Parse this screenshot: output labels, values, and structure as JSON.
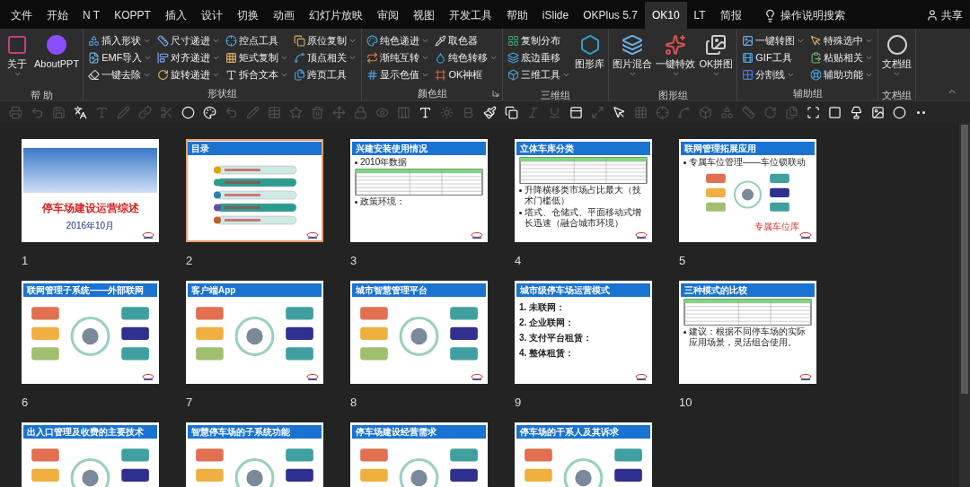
{
  "menu_tabs": [
    {
      "label": "文件",
      "selected": false
    },
    {
      "label": "开始",
      "selected": false
    },
    {
      "label": "N T",
      "selected": false
    },
    {
      "label": "KOPPT",
      "selected": false
    },
    {
      "label": "插入",
      "selected": false
    },
    {
      "label": "设计",
      "selected": false
    },
    {
      "label": "切换",
      "selected": false
    },
    {
      "label": "动画",
      "selected": false
    },
    {
      "label": "幻灯片放映",
      "selected": false
    },
    {
      "label": "审阅",
      "selected": false
    },
    {
      "label": "视图",
      "selected": false
    },
    {
      "label": "开发工具",
      "selected": false
    },
    {
      "label": "帮助",
      "selected": false
    },
    {
      "label": "iSlide",
      "selected": false
    },
    {
      "label": "OKPlus 5.7",
      "selected": false
    },
    {
      "label": "OK10",
      "selected": true
    },
    {
      "label": "LT",
      "selected": false
    },
    {
      "label": "简报",
      "selected": false
    }
  ],
  "search": {
    "placeholder": "操作说明搜索"
  },
  "share": "共享",
  "ribbon_groups": [
    {
      "label": "帮 助",
      "launcher": false,
      "items": [
        {
          "kind": "large",
          "label": "关于",
          "dropdown": true
        },
        {
          "kind": "large",
          "label": "AboutPPT",
          "dropdown": false
        }
      ]
    },
    {
      "label": "形状组",
      "launcher": false,
      "items": [
        {
          "kind": "column",
          "items": [
            {
              "label": "插入形状",
              "dropdown": true
            },
            {
              "label": "EMF导入",
              "dropdown": true
            },
            {
              "label": "一键去除",
              "dropdown": true
            }
          ]
        },
        {
          "kind": "column",
          "items": [
            {
              "label": "尺寸递进",
              "dropdown": true
            },
            {
              "label": "对齐递进",
              "dropdown": true
            },
            {
              "label": "旋转递进",
              "dropdown": true
            }
          ]
        },
        {
          "kind": "column",
          "items": [
            {
              "label": "控点工具",
              "dropdown": false
            },
            {
              "label": "矩式复制",
              "dropdown": true
            },
            {
              "label": "拆合文本",
              "dropdown": true
            }
          ]
        },
        {
          "kind": "column",
          "items": [
            {
              "label": "原位复制",
              "dropdown": true
            },
            {
              "label": "顶点相关",
              "dropdown": true
            },
            {
              "label": "跨页工具",
              "dropdown": false
            }
          ]
        }
      ]
    },
    {
      "label": "颜色组",
      "launcher": true,
      "items": [
        {
          "kind": "column",
          "items": [
            {
              "label": "纯色递进",
              "dropdown": true
            },
            {
              "label": "渐纯互转",
              "dropdown": true
            },
            {
              "label": "显示色值",
              "dropdown": true
            }
          ]
        },
        {
          "kind": "column",
          "items": [
            {
              "label": "取色器",
              "dropdown": false
            },
            {
              "label": "纯色转移",
              "dropdown": true
            },
            {
              "label": "OK神框",
              "dropdown": false
            }
          ]
        }
      ]
    },
    {
      "label": "三维组",
      "launcher": false,
      "items": [
        {
          "kind": "column",
          "items": [
            {
              "label": "复制分布",
              "dropdown": false
            },
            {
              "label": "底边垂移",
              "dropdown": false
            },
            {
              "label": "三维工具",
              "dropdown": true
            }
          ]
        },
        {
          "kind": "large",
          "label": "图形库",
          "dropdown": false
        }
      ]
    },
    {
      "label": "图形组",
      "launcher": false,
      "items": [
        {
          "kind": "large",
          "label": "图片混合",
          "dropdown": true
        },
        {
          "kind": "large",
          "label": "一键特效",
          "dropdown": true
        },
        {
          "kind": "large",
          "label": "OK拼图",
          "dropdown": true
        }
      ]
    },
    {
      "label": "辅助组",
      "launcher": false,
      "items": [
        {
          "kind": "column",
          "items": [
            {
              "label": "一键转图",
              "dropdown": true
            },
            {
              "label": "GIF工具",
              "dropdown": false
            },
            {
              "label": "分割线",
              "dropdown": true
            }
          ]
        },
        {
          "kind": "column",
          "items": [
            {
              "label": "特殊选中",
              "dropdown": true
            },
            {
              "label": "粘贴相关",
              "dropdown": true
            },
            {
              "label": "辅助功能",
              "dropdown": true
            }
          ]
        }
      ]
    },
    {
      "label": "文档组",
      "launcher": false,
      "items": [
        {
          "kind": "large",
          "label": "文档组",
          "dropdown": true
        }
      ]
    }
  ],
  "quick_toolbar": [
    {
      "enabled": false
    },
    {
      "enabled": false
    },
    {
      "enabled": false
    },
    {
      "enabled": true
    },
    {
      "enabled": false
    },
    {
      "enabled": false
    },
    {
      "enabled": false
    },
    {
      "enabled": false
    },
    {
      "enabled": true
    },
    {
      "enabled": true
    },
    {
      "enabled": false
    },
    {
      "enabled": false
    },
    {
      "enabled": false
    },
    {
      "enabled": false
    },
    {
      "enabled": false
    },
    {
      "enabled": false
    },
    {
      "enabled": false
    },
    {
      "enabled": false
    },
    {
      "enabled": false
    },
    {
      "enabled": true
    },
    {
      "enabled": false
    },
    {
      "enabled": false
    },
    {
      "enabled": true
    },
    {
      "enabled": true
    },
    {
      "enabled": false
    },
    {
      "enabled": false
    },
    {
      "enabled": true
    },
    {
      "enabled": false
    },
    {
      "enabled": true
    },
    {
      "enabled": false
    },
    {
      "enabled": false
    },
    {
      "enabled": false
    },
    {
      "enabled": false
    },
    {
      "enabled": false
    },
    {
      "enabled": false
    },
    {
      "enabled": false
    },
    {
      "enabled": false
    },
    {
      "enabled": true
    },
    {
      "enabled": true
    },
    {
      "enabled": true
    },
    {
      "enabled": true
    },
    {
      "enabled": true
    },
    {
      "enabled": true
    }
  ],
  "slides": [
    {
      "number": "1",
      "selected": false,
      "kind": "cover",
      "title": "停车场建设运营综述",
      "date": "2016年10月"
    },
    {
      "number": "2",
      "selected": true,
      "kind": "content",
      "title": "目录",
      "body": [
        {
          "kind": "list-bars"
        }
      ]
    },
    {
      "number": "3",
      "selected": false,
      "kind": "content",
      "title": "兴建安装使用情况",
      "body": [
        {
          "kind": "bullet",
          "text": "2010年数据"
        },
        {
          "kind": "table"
        },
        {
          "kind": "bullet",
          "text": "政策环境："
        }
      ]
    },
    {
      "number": "4",
      "selected": false,
      "kind": "content",
      "title": "立体车库分类",
      "body": [
        {
          "kind": "table"
        },
        {
          "kind": "bullet",
          "text": "升降横移类市场占比最大（技术门槛低）"
        },
        {
          "kind": "bullet",
          "text": "塔式、仓储式、平面移动式增长迅速（融合城市环境）"
        }
      ]
    },
    {
      "number": "5",
      "selected": false,
      "kind": "content",
      "title": "联网管理拓展应用",
      "body": [
        {
          "kind": "bullet",
          "text": "专属车位管理——车位锁联动"
        },
        {
          "kind": "diagram"
        },
        {
          "kind": "caption",
          "text": "专属车位库"
        }
      ]
    },
    {
      "number": "6",
      "selected": false,
      "kind": "content",
      "title": "联网管理子系统——外部联网",
      "body": [
        {
          "kind": "diagram"
        }
      ]
    },
    {
      "number": "7",
      "selected": false,
      "kind": "content",
      "title": "客户端App",
      "body": [
        {
          "kind": "diagram"
        }
      ]
    },
    {
      "number": "8",
      "selected": false,
      "kind": "content",
      "title": "城市智慧管理平台",
      "body": [
        {
          "kind": "diagram"
        }
      ]
    },
    {
      "number": "9",
      "selected": false,
      "kind": "content",
      "title": "城市级停车场运营模式",
      "body": [
        {
          "kind": "numbered",
          "text": "1. 未联网："
        },
        {
          "kind": "numbered",
          "text": "2. 企业联网："
        },
        {
          "kind": "numbered",
          "text": "3. 支付平台租赁："
        },
        {
          "kind": "numbered",
          "text": "4. 整体租赁："
        }
      ]
    },
    {
      "number": "10",
      "selected": false,
      "kind": "content",
      "title": "三种模式的比较",
      "body": [
        {
          "kind": "table"
        },
        {
          "kind": "bullet",
          "text": "建议：根据不同停车场的实际应用场景，灵活组合使用。"
        }
      ]
    },
    {
      "selected": false,
      "kind": "content",
      "title": "出入口管理及收费的主要技术",
      "body": [
        {
          "kind": "diagram"
        }
      ]
    },
    {
      "selected": false,
      "kind": "content",
      "title": "智慧停车场的子系统功能",
      "body": [
        {
          "kind": "diagram"
        }
      ]
    },
    {
      "selected": false,
      "kind": "content",
      "title": "停车场建设经营需求",
      "body": [
        {
          "kind": "diagram"
        }
      ]
    },
    {
      "selected": false,
      "kind": "content",
      "title": "停车场的干系人及其诉求",
      "body": [
        {
          "kind": "diagram"
        }
      ]
    }
  ]
}
